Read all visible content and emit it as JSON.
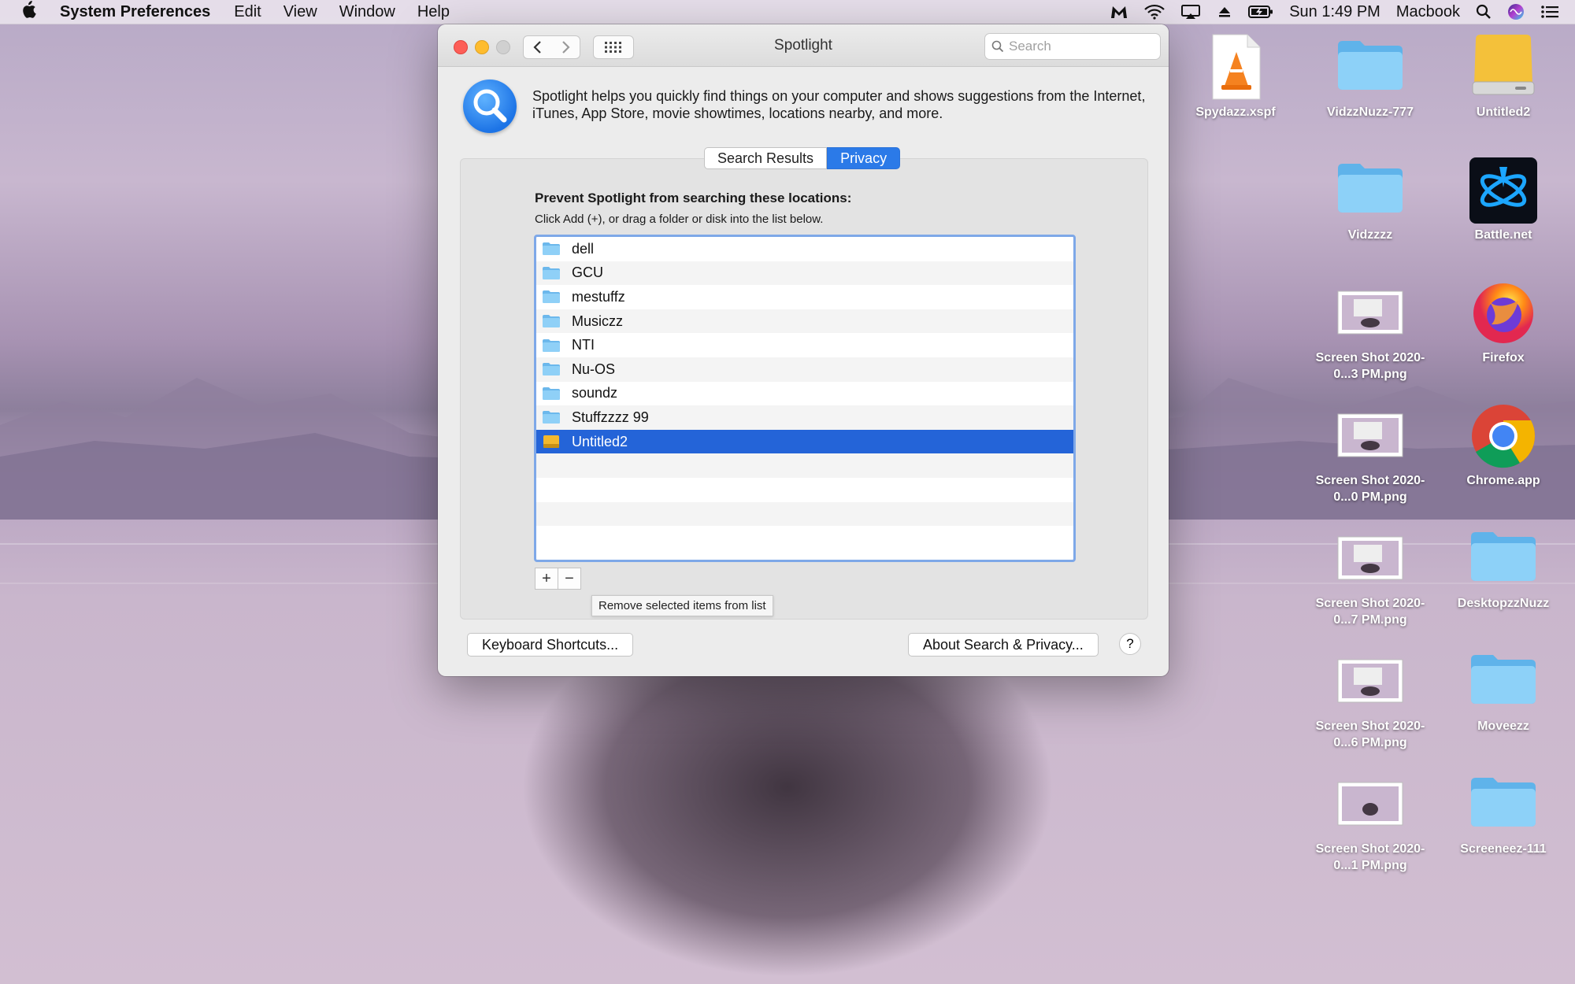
{
  "menubar": {
    "app_name": "System Preferences",
    "menus": [
      "Edit",
      "View",
      "Window",
      "Help"
    ],
    "clock": "Sun 1:49 PM",
    "user": "Macbook"
  },
  "window": {
    "title": "Spotlight",
    "search_placeholder": "Search",
    "description": "Spotlight helps you quickly find things on your computer and shows suggestions from the Internet, iTunes, App Store, movie showtimes, locations nearby, and more.",
    "tabs": [
      {
        "label": "Search Results",
        "active": false
      },
      {
        "label": "Privacy",
        "active": true
      }
    ],
    "privacy": {
      "title": "Prevent Spotlight from searching these locations:",
      "subtitle": "Click Add (+), or drag a folder or disk into the list below.",
      "items": [
        {
          "name": "dell",
          "type": "folder"
        },
        {
          "name": "GCU",
          "type": "folder"
        },
        {
          "name": "mestuffz",
          "type": "folder"
        },
        {
          "name": "Musiczz",
          "type": "folder"
        },
        {
          "name": "NTI",
          "type": "folder"
        },
        {
          "name": "Nu-OS",
          "type": "folder"
        },
        {
          "name": "soundz",
          "type": "folder"
        },
        {
          "name": "Stuffzzzz 99",
          "type": "folder"
        },
        {
          "name": "Untitled2",
          "type": "disk",
          "selected": true
        }
      ],
      "add_label": "+",
      "remove_label": "−",
      "tooltip": "Remove selected items from list"
    },
    "keyboard_shortcuts_label": "Keyboard Shortcuts...",
    "about_label": "About Search & Privacy...",
    "help_label": "?"
  },
  "desktop": {
    "icons": [
      {
        "label": "Spydazz.xspf",
        "kind": "file"
      },
      {
        "label": "VidzzNuzz-777",
        "kind": "folder"
      },
      {
        "label": "Untitled2",
        "kind": "disk"
      },
      {
        "label": "Vidzzzz",
        "kind": "folder"
      },
      {
        "label": "Battle.net",
        "kind": "app"
      },
      {
        "label": "Screen Shot 2020-0...3 PM.png",
        "kind": "screenshot"
      },
      {
        "label": "Firefox",
        "kind": "app"
      },
      {
        "label": "Screen Shot 2020-0...0 PM.png",
        "kind": "screenshot"
      },
      {
        "label": "Chrome.app",
        "kind": "app"
      },
      {
        "label": "Screen Shot 2020-0...7 PM.png",
        "kind": "screenshot"
      },
      {
        "label": "DesktopzzNuzz",
        "kind": "folder"
      },
      {
        "label": "Screen Shot 2020-0...6 PM.png",
        "kind": "screenshot"
      },
      {
        "label": "Moveezz",
        "kind": "folder"
      },
      {
        "label": "Screen Shot 2020-0...1 PM.png",
        "kind": "screenshot"
      },
      {
        "label": "Screeneez-111",
        "kind": "folder"
      }
    ]
  },
  "colors": {
    "accent": "#2b7ae8",
    "selection": "#2464d8",
    "folder": "#6cc0f3"
  }
}
